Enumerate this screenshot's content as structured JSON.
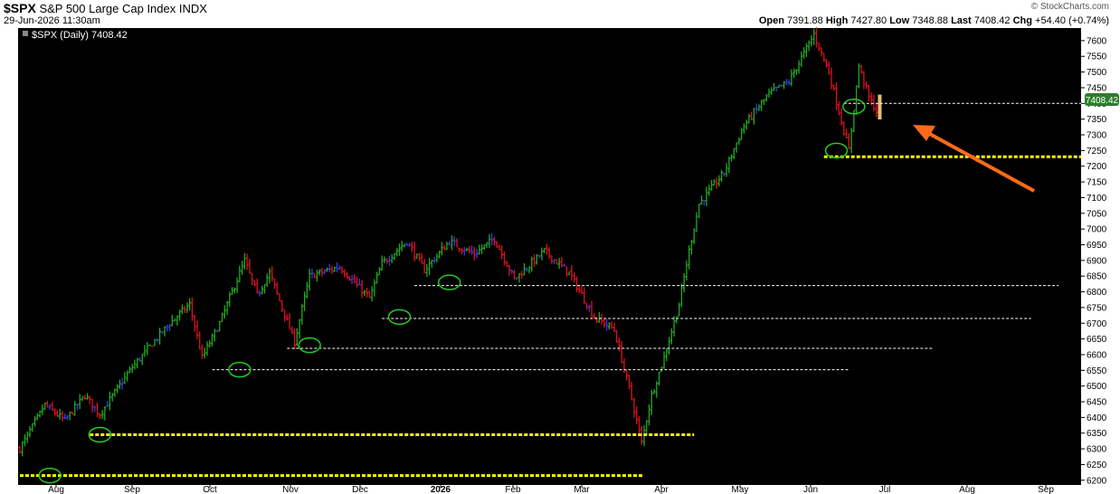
{
  "header": {
    "symbol": "$SPX",
    "name": "S&P 500 Large Cap Index",
    "exchange": "INDX",
    "datetime": "29-Jun-2026 11:30am",
    "brand": "© StockCharts.com"
  },
  "ohlc": {
    "open_label": "Open",
    "open": "7391.88",
    "high_label": "High",
    "high": "7427.80",
    "low_label": "Low",
    "low": "7348.88",
    "last_label": "Last",
    "last": "7408.42",
    "chg_label": "Chg",
    "chg": "+54.40 (+0.74%)"
  },
  "legend": {
    "text": "$SPX (Daily) 7408.42"
  },
  "colors": {
    "background": "#000000",
    "up_bar": "#22aa22",
    "down_bar": "#e01020",
    "neutral_bar": "#3a3ae0",
    "support_line": "#ffff00",
    "level_line": "#ffffff",
    "circle": "#22cc22",
    "arrow": "#ff6a1a",
    "price_tag": "#2e7d2e"
  },
  "chart_data": {
    "type": "ohlc",
    "yaxis": {
      "side": "right",
      "range": [
        6185,
        7640
      ],
      "ticks": [
        6200,
        6250,
        6300,
        6350,
        6400,
        6450,
        6500,
        6550,
        6600,
        6650,
        6700,
        6750,
        6800,
        6850,
        6900,
        6950,
        7000,
        7050,
        7100,
        7150,
        7200,
        7250,
        7300,
        7350,
        7400,
        7450,
        7500,
        7550,
        7600
      ]
    },
    "xaxis": {
      "labels": [
        "Aug",
        "Sep",
        "Oct",
        "Nov",
        "Dec",
        "2026",
        "Feb",
        "Mar",
        "Apr",
        "May",
        "Jun",
        "Jul",
        "Aug",
        "Sep"
      ],
      "bold": [
        "2026"
      ]
    },
    "last_price_tag": "7408.42",
    "path_anchors": [
      {
        "t": 0,
        "v": 6300
      },
      {
        "t": 10,
        "v": 6440
      },
      {
        "t": 18,
        "v": 6390
      },
      {
        "t": 26,
        "v": 6470
      },
      {
        "t": 32,
        "v": 6410
      },
      {
        "t": 45,
        "v": 6560
      },
      {
        "t": 60,
        "v": 6700
      },
      {
        "t": 68,
        "v": 6760
      },
      {
        "t": 73,
        "v": 6590
      },
      {
        "t": 80,
        "v": 6700
      },
      {
        "t": 90,
        "v": 6900
      },
      {
        "t": 95,
        "v": 6790
      },
      {
        "t": 100,
        "v": 6860
      },
      {
        "t": 110,
        "v": 6640
      },
      {
        "t": 116,
        "v": 6850
      },
      {
        "t": 128,
        "v": 6880
      },
      {
        "t": 140,
        "v": 6780
      },
      {
        "t": 145,
        "v": 6890
      },
      {
        "t": 155,
        "v": 6960
      },
      {
        "t": 162,
        "v": 6870
      },
      {
        "t": 172,
        "v": 6960
      },
      {
        "t": 182,
        "v": 6920
      },
      {
        "t": 190,
        "v": 6970
      },
      {
        "t": 198,
        "v": 6840
      },
      {
        "t": 210,
        "v": 6930
      },
      {
        "t": 220,
        "v": 6860
      },
      {
        "t": 230,
        "v": 6720
      },
      {
        "t": 238,
        "v": 6680
      },
      {
        "t": 245,
        "v": 6460
      },
      {
        "t": 249,
        "v": 6320
      },
      {
        "t": 253,
        "v": 6470
      },
      {
        "t": 258,
        "v": 6590
      },
      {
        "t": 264,
        "v": 6760
      },
      {
        "t": 268,
        "v": 6930
      },
      {
        "t": 272,
        "v": 7080
      },
      {
        "t": 282,
        "v": 7180
      },
      {
        "t": 290,
        "v": 7330
      },
      {
        "t": 300,
        "v": 7430
      },
      {
        "t": 308,
        "v": 7470
      },
      {
        "t": 318,
        "v": 7620
      },
      {
        "t": 324,
        "v": 7500
      },
      {
        "t": 332,
        "v": 7250
      },
      {
        "t": 336,
        "v": 7520
      },
      {
        "t": 340,
        "v": 7420
      },
      {
        "t": 344,
        "v": 7360
      }
    ],
    "support_lines": [
      {
        "price": 6215,
        "from_t": 0,
        "to_t": 250,
        "style": "thick"
      },
      {
        "price": 6345,
        "from_t": 28,
        "to_t": 270,
        "style": "thick"
      },
      {
        "price": 6552,
        "from_t": 77,
        "to_t": 332,
        "style": "dashed"
      },
      {
        "price": 6620,
        "from_t": 107,
        "to_t": 366,
        "style": "dashed"
      },
      {
        "price": 6715,
        "from_t": 145,
        "to_t": 405,
        "style": "dashed"
      },
      {
        "price": 6820,
        "from_t": 158,
        "to_t": 416,
        "style": "dashed"
      },
      {
        "price": 7230,
        "from_t": 322,
        "to_t": 460,
        "style": "thick"
      },
      {
        "price": 7400,
        "from_t": 330,
        "to_t": 460,
        "style": "dashed"
      }
    ],
    "circled_lows": [
      {
        "t": 12,
        "price": 6215
      },
      {
        "t": 32,
        "price": 6345
      },
      {
        "t": 88,
        "price": 6552
      },
      {
        "t": 116,
        "price": 6630
      },
      {
        "t": 152,
        "price": 6720
      },
      {
        "t": 172,
        "price": 6830
      },
      {
        "t": 327,
        "price": 7250
      },
      {
        "t": 334,
        "price": 7390
      }
    ]
  }
}
